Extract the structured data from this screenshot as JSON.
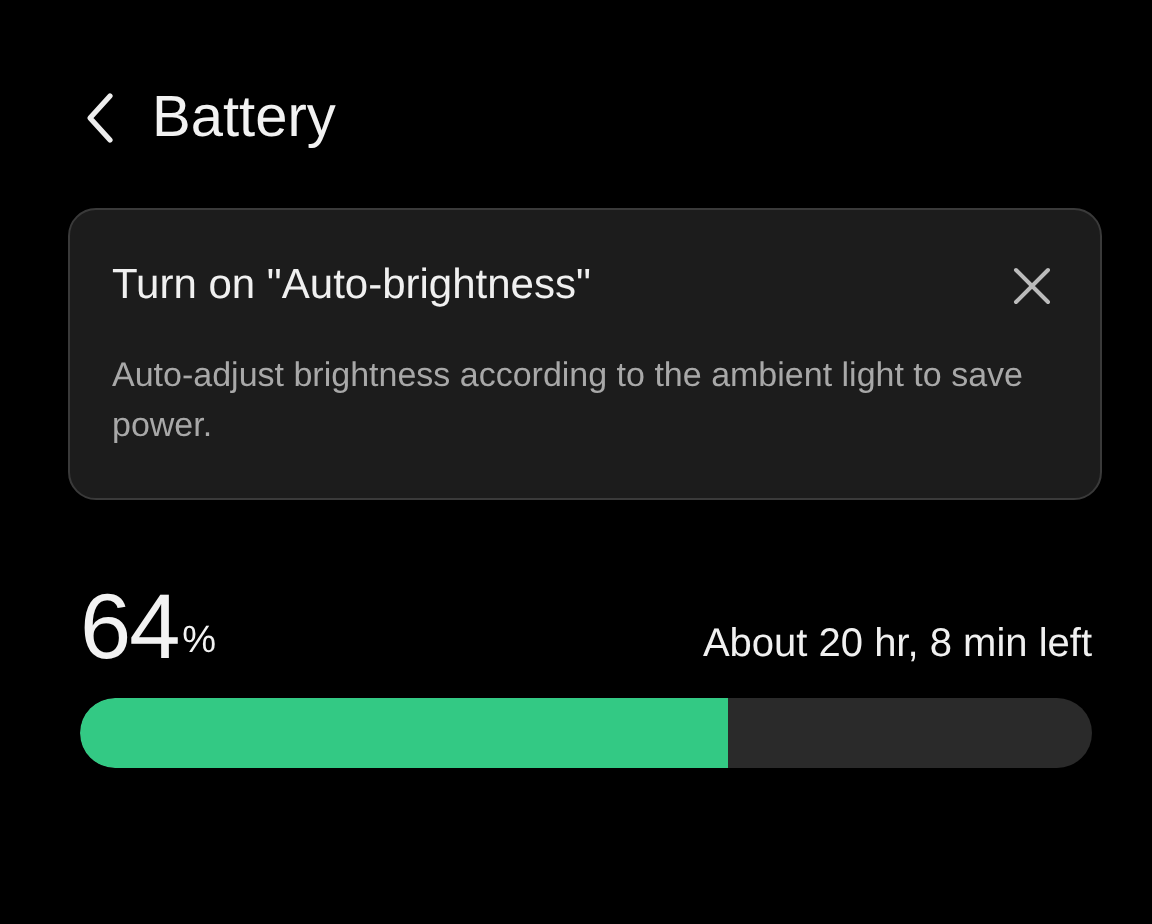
{
  "header": {
    "title": "Battery"
  },
  "tip": {
    "title": "Turn on \"Auto-brightness\"",
    "description": "Auto-adjust brightness according to the ambient light to save power."
  },
  "battery": {
    "percent": "64",
    "unit": "%",
    "remaining": "About 20 hr, 8 min left",
    "level": 0.64
  }
}
